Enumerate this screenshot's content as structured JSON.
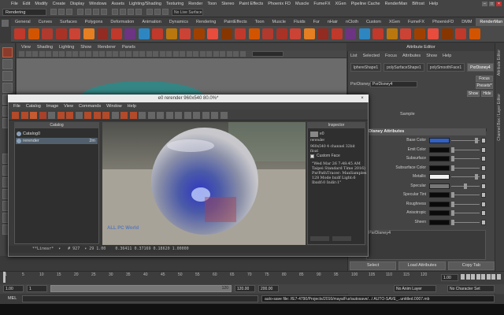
{
  "main_menu": [
    "File",
    "Edit",
    "Modify",
    "Create",
    "Display",
    "Windows",
    "Assets",
    "Lighting/Shading",
    "Texturing",
    "Render",
    "Toon",
    "Stereo",
    "Paint Effects",
    "Phoenix FD",
    "Muscle",
    "FumeFX",
    "XGen",
    "Pipeline Cache",
    "RenderMan",
    "Bifrost",
    "Help"
  ],
  "status_line": {
    "mode": "Rendering",
    "surface_field": "No Live Surface"
  },
  "shelf_tabs": [
    "General",
    "Curves",
    "Surfaces",
    "Polygons",
    "Deformation",
    "Animation",
    "Dynamics",
    "Rendering",
    "PaintEffects",
    "Toon",
    "Muscle",
    "Fluids",
    "Fur",
    "nHair",
    "nCloth",
    "Custom",
    "XGen",
    "FumeFX",
    "PhoenixFD",
    "DMM",
    "RenderMan"
  ],
  "shelf_active": "RenderMan",
  "viewport_menu": [
    "View",
    "Shading",
    "Lighting",
    "Show",
    "Renderer",
    "Panels"
  ],
  "attribute_editor": {
    "title": "Attribute Editor",
    "menu": [
      "List",
      "Selected",
      "Focus",
      "Attributes",
      "Show",
      "Help"
    ],
    "tabs": [
      "lphereShape1",
      "polySurfaceShape1",
      "polySmoothFace1",
      "PxrDisney4"
    ],
    "active_tab": "PxrDisney4",
    "type_label": "PxrDisney:",
    "name_value": "PxrDisney4",
    "focus_button": "Focus",
    "presets_button": "Presets*",
    "show_button": "Show",
    "hide_button": "Hide",
    "sample_label": "Sample",
    "section_title": "Disney Attributes",
    "attributes": [
      {
        "label": "Base Color",
        "type": "color",
        "color": "#3060c8",
        "knob": 0.95
      },
      {
        "label": "Emit Color",
        "type": "color",
        "color": "#0a0a0a",
        "knob": 0.0
      },
      {
        "label": "Subsurface",
        "type": "value",
        "color": "#0a0a0a",
        "knob": 0.0
      },
      {
        "label": "Subsurface Color",
        "type": "color",
        "color": "#0a0a0a",
        "knob": 0.0
      },
      {
        "label": "Metallic",
        "type": "value",
        "color": "#f0f0f0",
        "knob": 0.95
      },
      {
        "label": "Specular",
        "type": "value",
        "color": "#777777",
        "knob": 0.5
      },
      {
        "label": "Specular Tint",
        "type": "value",
        "color": "#0a0a0a",
        "knob": 0.0
      },
      {
        "label": "Roughness",
        "type": "value",
        "color": "#0a0a0a",
        "knob": 0.0
      },
      {
        "label": "Anisotropic",
        "type": "value",
        "color": "#0a0a0a",
        "knob": 0.0
      },
      {
        "label": "Sheen",
        "type": "value",
        "color": "#0a0a0a",
        "knob": 0.0
      }
    ],
    "notes_label": "PxrDisney4",
    "bottom_buttons": [
      "Select",
      "Load Attributes",
      "Copy Tab"
    ],
    "side_labels": [
      "Attribute Editor",
      "Channel Box / Layer Editor"
    ]
  },
  "render_window": {
    "title": "e0 rerender 960x540 80.0%*",
    "menu": [
      "File",
      "Catalog",
      "Image",
      "View",
      "Commands",
      "Window",
      "Help"
    ],
    "catalog_title": "Catalog",
    "catalog_items": [
      {
        "label": "Catalog0",
        "value": ""
      },
      {
        "label": "rerender",
        "value": "2m"
      }
    ],
    "inspector_title": "Inspector",
    "inspector_name": "e0",
    "inspector_sub": "rerender",
    "inspector_size": "960x540 4 channel 32bit float",
    "custom_face_label": "Custom Face",
    "inspector_info": "\"Wed Mar 26 7:48:45 AM\nTaipei Standard Time 2016)\nPxrPathTracer: MaxSamples\n128 Mode bxdf Light:6\nIbxdf:0 Indir:1\"",
    "watermark": "ALL PC World",
    "status": "**Linear*  ▾   # 927  ▾ 29 1.00    0.36411 0.37169 0.18620 1.00000"
  },
  "timeline": {
    "ticks": [
      "1",
      "5",
      "10",
      "15",
      "20",
      "25",
      "30",
      "35",
      "40",
      "45",
      "50",
      "55",
      "60",
      "65",
      "70",
      "75",
      "80",
      "85",
      "90",
      "95",
      "100",
      "105",
      "110",
      "115",
      "120"
    ],
    "current_frame": "1.00",
    "range_start": "1.00",
    "range_inner_start": "1",
    "range_inner_end": "120",
    "range_end": "120.00",
    "anim_end": "200.00",
    "anim_layer": "No Anim Layer",
    "character_set": "No Character Set"
  },
  "command_line": {
    "label": "MEL",
    "output": "auto-save file: //E7-4790/Projects/2016/maya/Fur/autosave/.../ AUTO-SAVE_..untitled.0007.mb"
  },
  "colors": {
    "accent": "#3060c8",
    "panel": "#444444",
    "field": "#2b2b2b"
  }
}
